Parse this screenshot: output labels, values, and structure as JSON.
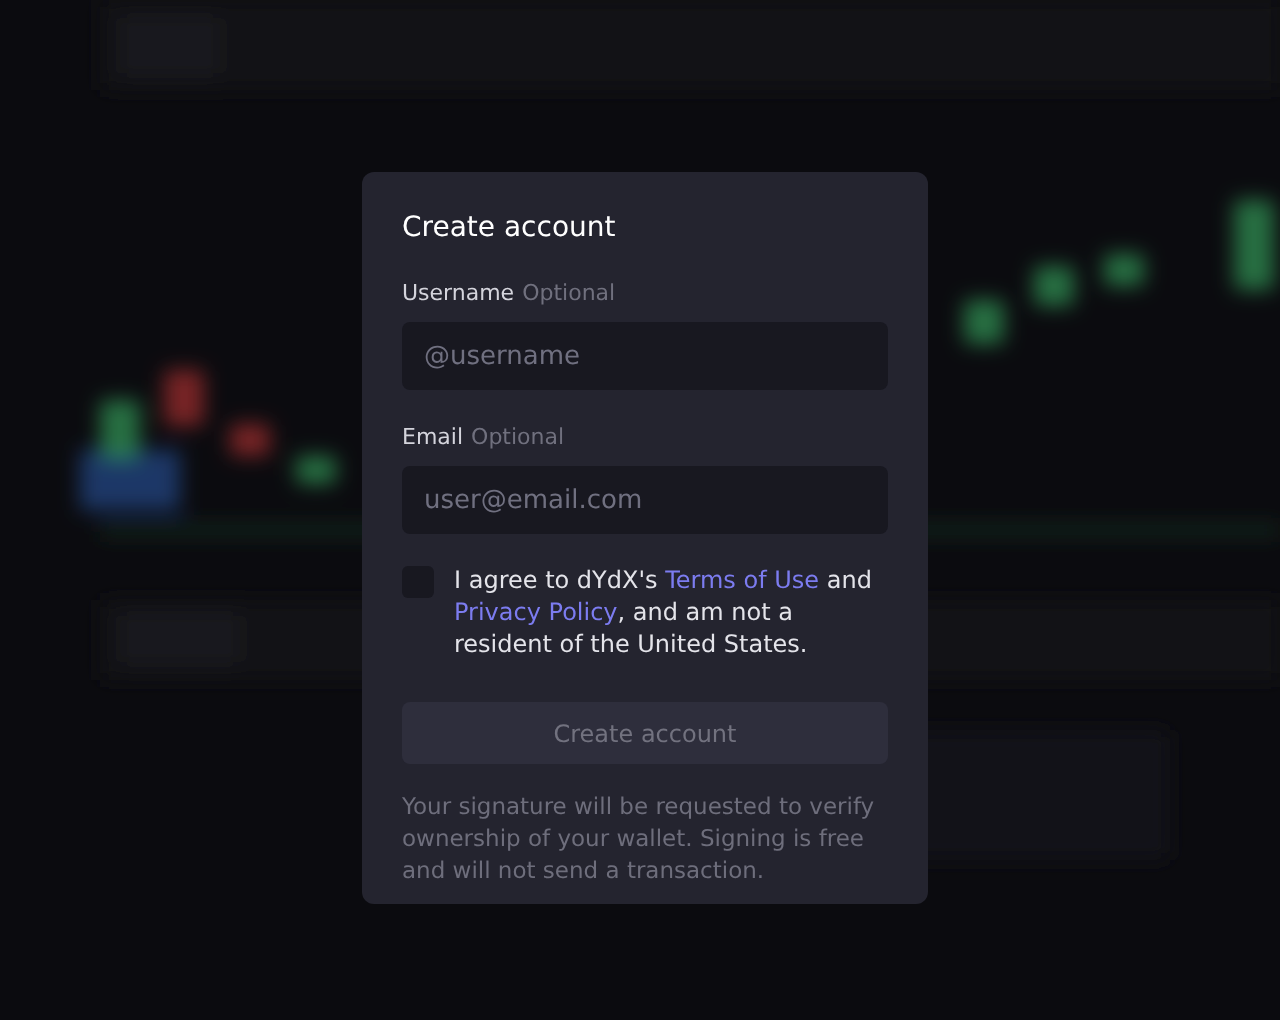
{
  "dialog": {
    "title": "Create account",
    "fields": [
      {
        "label": "Username",
        "hint": "Optional",
        "placeholder": "@username"
      },
      {
        "label": "Email",
        "hint": "Optional",
        "placeholder": "user@email.com"
      }
    ],
    "agreement": {
      "checked": false,
      "parts": [
        {
          "kind": "text",
          "text": "I agree to dYdX's "
        },
        {
          "kind": "link",
          "text": "Terms of Use"
        },
        {
          "kind": "text",
          "text": " and "
        },
        {
          "kind": "link",
          "text": "Privacy Policy"
        },
        {
          "kind": "text",
          "text": ", and am not a resident of the United States."
        }
      ]
    },
    "submit": {
      "label": "Create account",
      "disabled": true
    },
    "note": "Your signature will be requested to verify ownership of your wallet. Signing is free and will not send a transaction."
  }
}
